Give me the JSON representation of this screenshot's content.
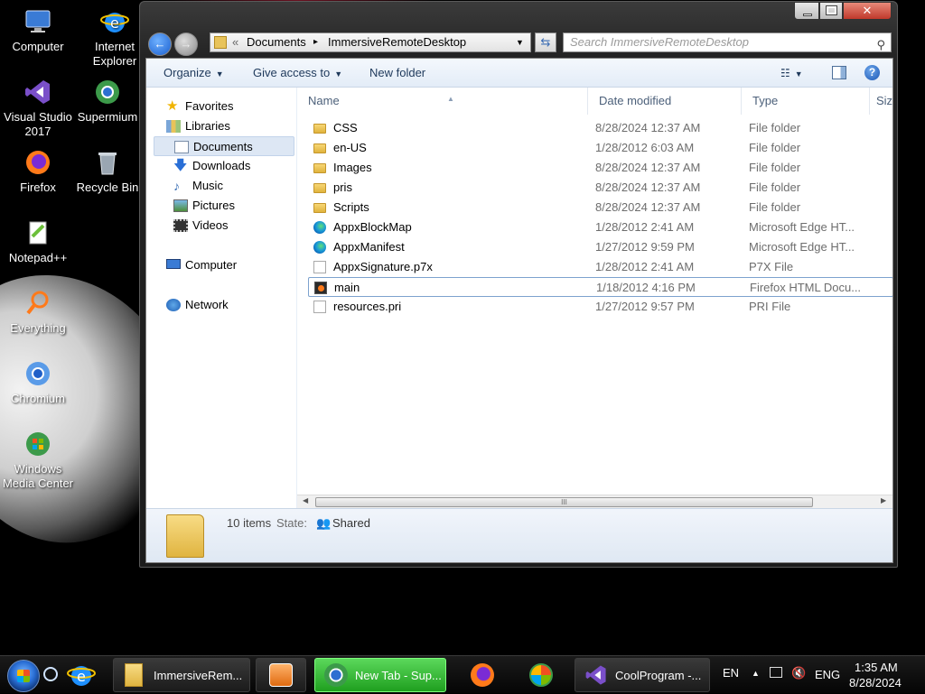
{
  "desktop": {
    "icons": [
      {
        "label": "Computer",
        "icon": "computer-icon"
      },
      {
        "label": "Internet Explorer",
        "line1": "Internet",
        "line2": "Explorer",
        "icon": "ie-icon"
      },
      {
        "label": "Visual Studio 2017",
        "line1": "Visual Studio",
        "line2": "2017",
        "icon": "visual-studio-icon"
      },
      {
        "label": "Supermium",
        "icon": "supermium-icon"
      },
      {
        "label": "Firefox",
        "icon": "firefox-icon"
      },
      {
        "label": "Recycle Bin",
        "icon": "recycle-bin-icon"
      },
      {
        "label": "Notepad++",
        "icon": "notepadpp-icon"
      },
      {
        "label": "Everything",
        "icon": "everything-icon"
      },
      {
        "label": "Chromium",
        "icon": "chromium-icon"
      },
      {
        "label": "Windows Media Center",
        "line1": "Windows",
        "line2": "Media Center",
        "icon": "media-center-icon"
      }
    ]
  },
  "explorer": {
    "address": {
      "overflow": "«",
      "crumbs": [
        "Documents",
        "ImmersiveRemoteDesktop"
      ],
      "separator": "▸"
    },
    "search_placeholder": "Search ImmersiveRemoteDesktop",
    "toolbar": {
      "organize": "Organize",
      "give_access": "Give access to",
      "new_folder": "New folder"
    },
    "nav": {
      "favorites": "Favorites",
      "libraries": "Libraries",
      "documents": "Documents",
      "downloads": "Downloads",
      "music": "Music",
      "pictures": "Pictures",
      "videos": "Videos",
      "computer": "Computer",
      "network": "Network"
    },
    "columns": {
      "name": "Name",
      "date": "Date modified",
      "type": "Type",
      "size": "Size"
    },
    "files": [
      {
        "name": "CSS",
        "date": "8/28/2024 12:37 AM",
        "type": "File folder",
        "icon": "folder-icon"
      },
      {
        "name": "en-US",
        "date": "1/28/2012 6:03 AM",
        "type": "File folder",
        "icon": "folder-icon"
      },
      {
        "name": "Images",
        "date": "8/28/2024 12:37 AM",
        "type": "File folder",
        "icon": "folder-icon"
      },
      {
        "name": "pris",
        "date": "8/28/2024 12:37 AM",
        "type": "File folder",
        "icon": "folder-icon"
      },
      {
        "name": "Scripts",
        "date": "8/28/2024 12:37 AM",
        "type": "File folder",
        "icon": "folder-icon"
      },
      {
        "name": "AppxBlockMap",
        "date": "1/28/2012 2:41 AM",
        "type": "Microsoft Edge HT...",
        "icon": "edge-icon"
      },
      {
        "name": "AppxManifest",
        "date": "1/27/2012 9:59 PM",
        "type": "Microsoft Edge HT...",
        "icon": "edge-icon"
      },
      {
        "name": "AppxSignature.p7x",
        "date": "1/28/2012 2:41 AM",
        "type": "P7X File",
        "icon": "file-icon"
      },
      {
        "name": "main",
        "date": "1/18/2012 4:16 PM",
        "type": "Firefox HTML Docu...",
        "icon": "firefox-doc-icon"
      },
      {
        "name": "resources.pri",
        "date": "1/27/2012 9:57 PM",
        "type": "PRI File",
        "icon": "file-icon"
      }
    ],
    "details": {
      "count": "10 items",
      "state_label": "State:",
      "state_value": "Shared"
    },
    "scroll_grip": "III"
  },
  "taskbar": {
    "buttons": [
      {
        "label": "ImmersiveRem...",
        "icon": "folder-icon"
      },
      {
        "label": "",
        "icon": "media-player-icon"
      },
      {
        "label": "New Tab - Sup...",
        "icon": "supermium-icon"
      },
      {
        "label": "",
        "icon": "firefox-icon"
      },
      {
        "label": "",
        "icon": "media-center-icon"
      },
      {
        "label": "CoolProgram -...",
        "icon": "visual-studio-icon"
      }
    ],
    "tray": {
      "lang": "EN",
      "arrow": "▲",
      "kbd": "ENG",
      "time": "1:35 AM",
      "date": "8/28/2024"
    }
  },
  "colors": {
    "accent_blue": "#1e395b",
    "active_task": "#3fbf3f",
    "selection_border": "#7da2ce"
  }
}
